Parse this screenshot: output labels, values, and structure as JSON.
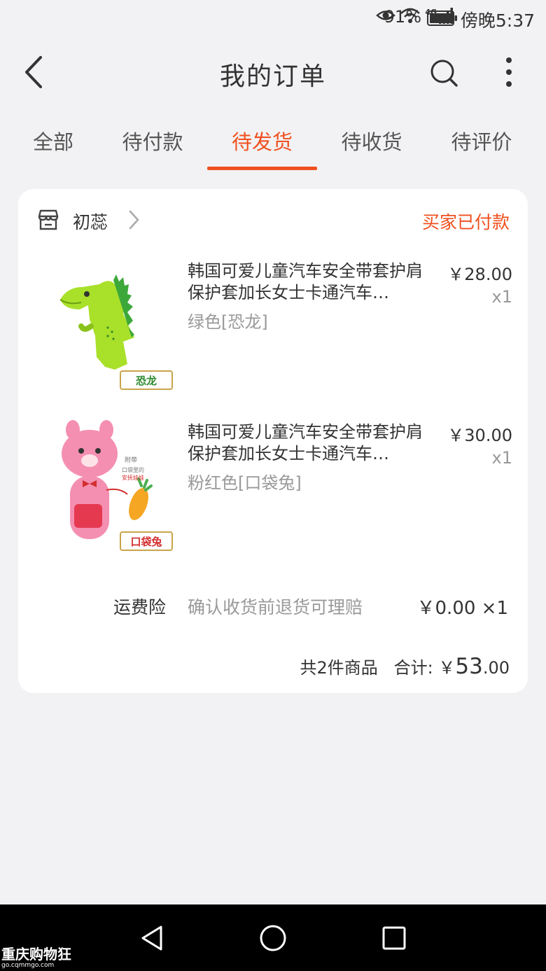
{
  "status_bar": {
    "battery_percent": "91%",
    "time": "傍晚5:37",
    "network": "4G"
  },
  "header": {
    "title": "我的订单"
  },
  "tabs": [
    {
      "label": "全部",
      "active": false
    },
    {
      "label": "待付款",
      "active": false
    },
    {
      "label": "待发货",
      "active": true
    },
    {
      "label": "待收货",
      "active": false
    },
    {
      "label": "待评价",
      "active": false
    }
  ],
  "order": {
    "shop_name": "初蕊",
    "status": "买家已付款",
    "items": [
      {
        "title": "韩国可爱儿童汽车安全带套护肩保护套加长女士卡通汽车…",
        "sku": "绿色[恐龙]",
        "price": "￥28.00",
        "quantity": "x1",
        "image_label": "恐龙"
      },
      {
        "title": "韩国可爱儿童汽车安全带套护肩保护套加长女士卡通汽车…",
        "sku": "粉红色[口袋兔]",
        "price": "￥30.00",
        "quantity": "x1",
        "image_label": "口袋兔",
        "image_note_1": "附带",
        "image_note_2": "口袋里的",
        "image_note_3": "安抚娃娃"
      }
    ],
    "insurance": {
      "label": "运费险",
      "description": "确认收货前退货可理赔",
      "price": "￥0.00 ×1"
    },
    "summary": {
      "count_text": "共2件商品",
      "total_label": "合计:",
      "currency": "￥",
      "total_integer": "53",
      "total_decimal": ".00"
    }
  },
  "watermark": {
    "text": "重庆购物狂",
    "sub": "go.cqmmgo.com"
  },
  "colors": {
    "accent": "#f0501f",
    "background": "#f2f2f4",
    "card": "#ffffff",
    "muted_text": "#999999"
  }
}
